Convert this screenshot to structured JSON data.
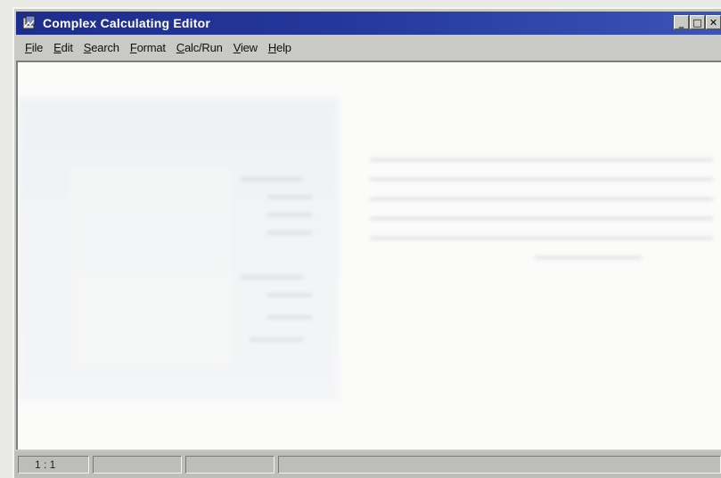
{
  "window": {
    "title": "Complex Calculating Editor",
    "controls": {
      "minimize": "_",
      "maximize": "□",
      "close": "✕"
    }
  },
  "menu": {
    "file": {
      "underline": "F",
      "rest": "ile"
    },
    "edit": {
      "underline": "E",
      "rest": "dit"
    },
    "search": {
      "underline": "S",
      "rest": "earch"
    },
    "format": {
      "underline": "F",
      "rest": "ormat"
    },
    "calcrun": {
      "underline": "C",
      "rest": "alc/Run"
    },
    "view": {
      "underline": "V",
      "rest": "iew"
    },
    "help": {
      "underline": "H",
      "rest": "elp"
    }
  },
  "statusbar": {
    "position": "1 : 1",
    "cell2": "",
    "cell3": "",
    "cell4": ""
  },
  "colors": {
    "titlebar": "#1d2d8e",
    "chrome": "#c9c9c6",
    "editor_bg": "#fbfbfa"
  }
}
